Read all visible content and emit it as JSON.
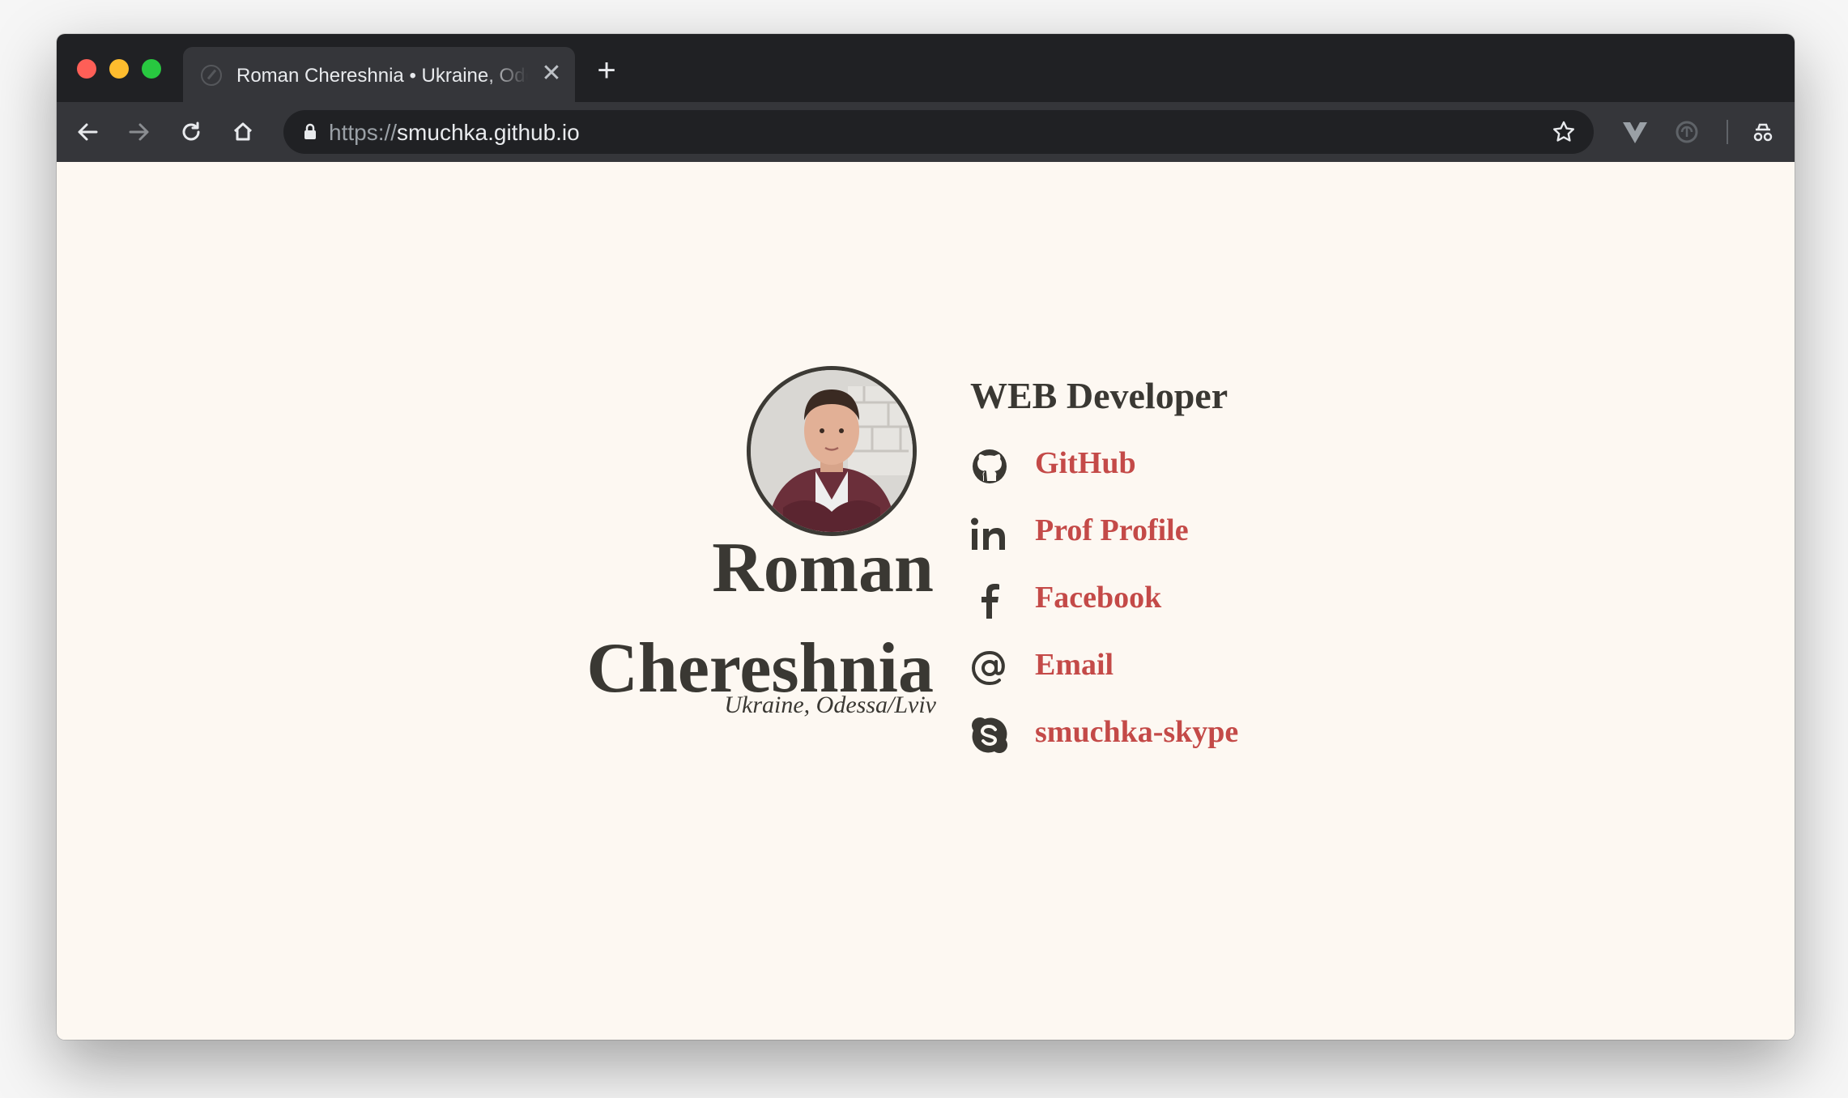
{
  "browser": {
    "tab_title": "Roman Chereshnia • Ukraine, Odessa/Lviv",
    "close_symbol": "✕",
    "new_tab_symbol": "+",
    "url_scheme": "https://",
    "url_host": "smuchka.github.io",
    "icons": [
      "back-arrow-icon",
      "forward-arrow-icon",
      "reload-icon",
      "home-icon",
      "lock-icon",
      "star-icon",
      "vue-devtools-icon",
      "extension-icon",
      "incognito-icon",
      "profile-icon"
    ]
  },
  "colors": {
    "page_background": "#fdf8f2",
    "text": "#3a3833",
    "link": "#c44a48",
    "tabstrip": "#202124",
    "toolbar": "#35363a"
  },
  "profile": {
    "name_first": "Roman",
    "name_last": "Chereshnia",
    "location": "Ukraine, Odessa/Lviv",
    "role": "WEB Developer"
  },
  "links": [
    {
      "label": "GitHub",
      "icon": "github-icon"
    },
    {
      "label": "Prof Profile",
      "icon": "linkedin-icon"
    },
    {
      "label": "Facebook",
      "icon": "facebook-icon"
    },
    {
      "label": "Email",
      "icon": "at-icon"
    },
    {
      "label": "smuchka-skype",
      "icon": "skype-icon"
    }
  ]
}
